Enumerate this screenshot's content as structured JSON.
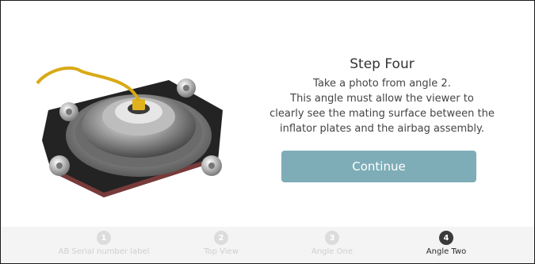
{
  "step": {
    "title": "Step Four",
    "instruction_lines": [
      "Take a photo from angle 2.",
      "This angle must allow the viewer to",
      "clearly see the mating surface between the",
      "inflator plates and the airbag assembly."
    ],
    "continue_label": "Continue"
  },
  "progress": {
    "steps": [
      {
        "number": "1",
        "label": "AB Serial number label",
        "state": "inactive"
      },
      {
        "number": "2",
        "label": "Top View",
        "state": "inactive"
      },
      {
        "number": "3",
        "label": "Angle One",
        "state": "inactive"
      },
      {
        "number": "4",
        "label": "Angle Two",
        "state": "active"
      }
    ]
  },
  "colors": {
    "button": "#7eadb8",
    "active_step": "#3a3a3a",
    "inactive_step": "#dcdcdc",
    "connector_wire": "#e0b21c"
  },
  "image": {
    "subject": "airbag inflator assembly"
  }
}
